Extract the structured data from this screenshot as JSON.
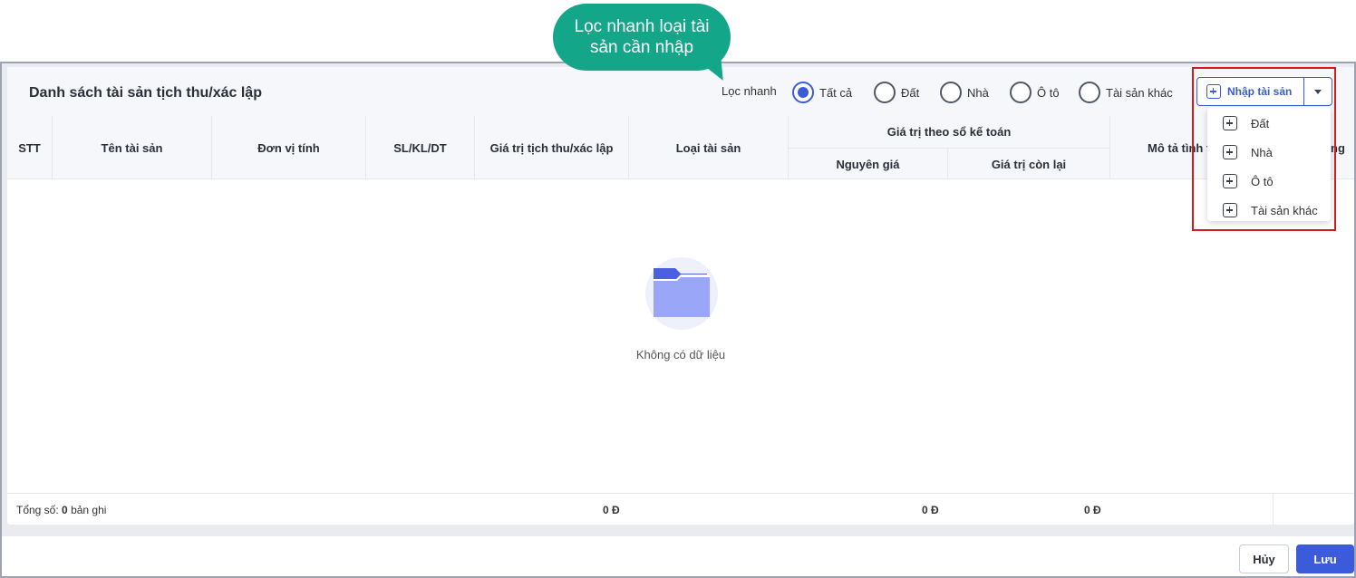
{
  "callout": {
    "text": "Lọc nhanh loại tài sản cần nhập"
  },
  "panel": {
    "title": "Danh sách tài sản tịch thu/xác lập"
  },
  "filter": {
    "label": "Lọc nhanh",
    "options": [
      "Tất cả",
      "Đất",
      "Nhà",
      "Ô tô",
      "Tài sản khác"
    ],
    "selected": "Tất cả"
  },
  "add_button": {
    "label": "Nhập tài sản"
  },
  "dropdown": {
    "items": [
      "Đất",
      "Nhà",
      "Ô tô",
      "Tài sản khác"
    ]
  },
  "table": {
    "headers": {
      "stt": "STT",
      "name": "Tên tài sản",
      "unit": "Đơn vị tính",
      "qty": "SL/KL/DT",
      "value": "Giá trị tịch thu/xác lập",
      "type": "Loại tài sản",
      "accounting_group": "Giá trị theo sổ kế toán",
      "original": "Nguyên giá",
      "remaining": "Giá trị còn lại",
      "desc": "Mô tả tình t",
      "last_partial": "ng"
    },
    "empty_text": "Không có dữ liệu",
    "footer": {
      "total_prefix": "Tổng số:",
      "total_count": "0",
      "total_suffix": "bản ghi",
      "sum_value": "0 Đ",
      "sum_original": "0 Đ",
      "sum_remaining": "0 Đ"
    }
  },
  "actions": {
    "cancel": "Hủy",
    "save": "Lưu"
  },
  "colors": {
    "primary": "#3b5bdb",
    "callout": "#13a689",
    "highlight": "#d01c1f"
  }
}
